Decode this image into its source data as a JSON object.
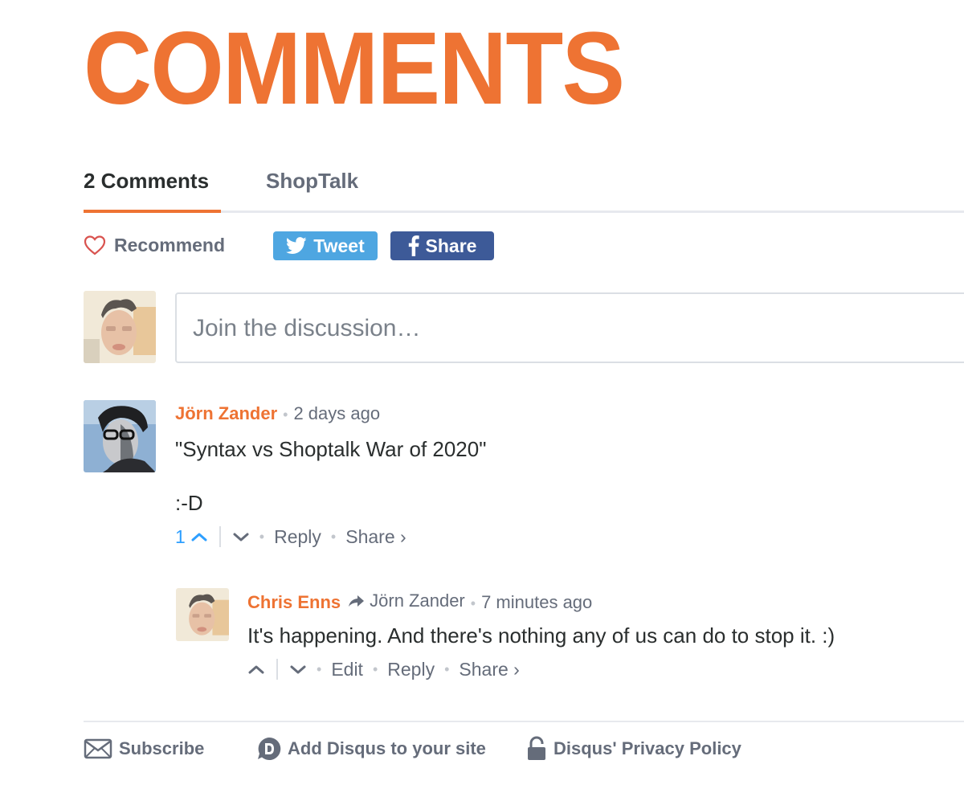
{
  "page": {
    "title": "COMMENTS"
  },
  "tabs": {
    "comments": "2 Comments",
    "community": "ShopTalk"
  },
  "actions_bar": {
    "recommend": "Recommend",
    "tweet": "Tweet",
    "share": "Share"
  },
  "composer": {
    "placeholder": "Join the discussion…"
  },
  "comments": [
    {
      "author": "Jörn Zander",
      "time": "2 days ago",
      "lines": [
        "\"Syntax vs Shoptalk War of 2020\"",
        ":-D"
      ],
      "upvotes": "1",
      "reply": "Reply",
      "share": "Share ›"
    },
    {
      "author": "Chris Enns",
      "reply_to": "Jörn Zander",
      "time": "7 minutes ago",
      "lines": [
        "It's happening. And there's nothing any of us can do to stop it. :)"
      ],
      "edit": "Edit",
      "reply": "Reply",
      "share": "Share ›"
    }
  ],
  "footer": {
    "subscribe": "Subscribe",
    "add_disqus": "Add Disqus to your site",
    "privacy": "Disqus' Privacy Policy"
  },
  "colors": {
    "accent": "#ee7333",
    "twitter": "#4ea6e1",
    "facebook": "#3d5a98",
    "upvote": "#2e9fff",
    "muted": "#656c7a"
  },
  "icons": [
    "heart-icon",
    "twitter-icon",
    "facebook-icon",
    "upvote-icon",
    "downvote-icon",
    "reply-arrow-icon",
    "envelope-icon",
    "disqus-logo-icon",
    "lock-icon"
  ]
}
